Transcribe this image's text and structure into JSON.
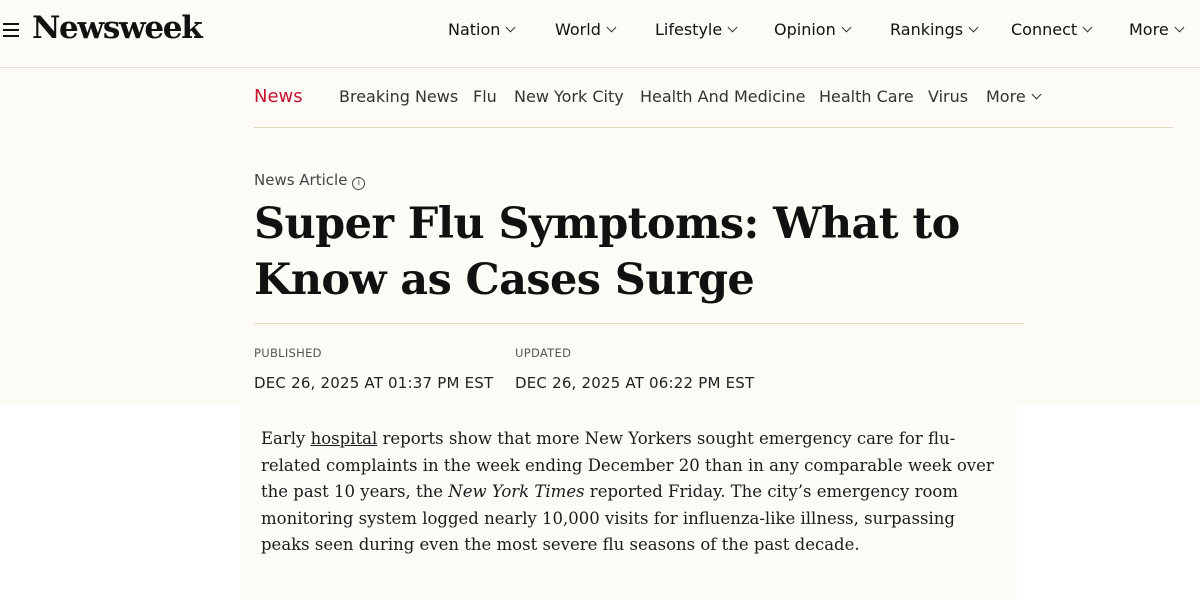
{
  "header": {
    "logo": "Newsweek",
    "nav": [
      {
        "label": "Nation"
      },
      {
        "label": "World"
      },
      {
        "label": "Lifestyle"
      },
      {
        "label": "Opinion"
      },
      {
        "label": "Rankings"
      },
      {
        "label": "Connect"
      },
      {
        "label": "More"
      }
    ]
  },
  "subnav": {
    "active": "News",
    "items": [
      "Breaking News",
      "Flu",
      "New York City",
      "Health And Medicine",
      "Health Care",
      "Virus",
      "More"
    ]
  },
  "article": {
    "type_label": "News Article",
    "info_icon": "i",
    "headline": "Super Flu Symptoms: What to Know as Cases Surge",
    "published_label": "PUBLISHED",
    "published_value": "DEC 26, 2025 AT 01:37 PM EST",
    "updated_label": "UPDATED",
    "updated_value": "DEC 26, 2025 AT 06:22 PM EST",
    "body": {
      "part1": "Early ",
      "link": "hospital",
      "part2": " reports show that more New Yorkers sought emergency care for flu-related complaints in the week ending December 20 than in any comparable week over the past 10 years, the ",
      "italic": "New York Times",
      "part3": " reported Friday. The city’s emergency room monitoring system logged nearly 10,000 visits for influenza-like illness, surpassing peaks seen during even the most severe flu seasons of the past decade."
    }
  }
}
